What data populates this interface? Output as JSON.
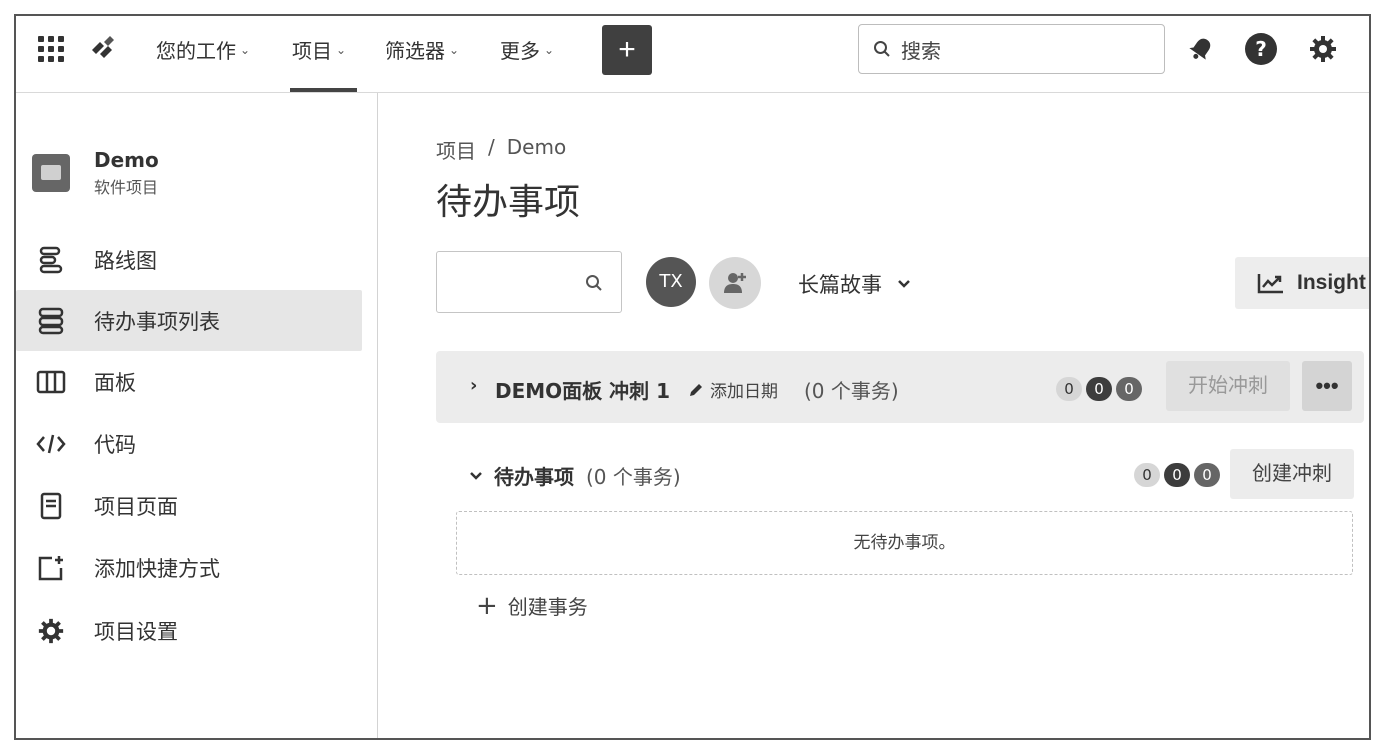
{
  "topbar": {
    "menus": [
      {
        "label": "您的工作"
      },
      {
        "label": "项目"
      },
      {
        "label": "筛选器"
      },
      {
        "label": "更多"
      }
    ],
    "create_label": "+",
    "search_placeholder": "搜索",
    "icons": [
      "apps-grid-icon",
      "jira-logo-icon",
      "notification-bell-icon",
      "help-icon",
      "settings-gear-icon"
    ],
    "help_glyph": "?"
  },
  "sidebar": {
    "project_name": "Demo",
    "project_type": "软件项目",
    "items": [
      {
        "label": "路线图",
        "icon": "roadmap-icon"
      },
      {
        "label": "待办事项列表",
        "icon": "backlog-icon",
        "active": true
      },
      {
        "label": "面板",
        "icon": "board-icon"
      },
      {
        "label": "代码",
        "icon": "code-icon"
      },
      {
        "label": "项目页面",
        "icon": "page-icon"
      },
      {
        "label": "添加快捷方式",
        "icon": "add-shortcut-icon"
      },
      {
        "label": "项目设置",
        "icon": "settings-gear-icon"
      }
    ]
  },
  "main": {
    "breadcrumb": {
      "root": "项目",
      "separator": "/",
      "current": "Demo"
    },
    "title": "待办事项",
    "avatar_initials": "TX",
    "epic_filter_label": "长篇故事",
    "insight_label": "Insight",
    "sprint": {
      "name": "DEMO面板 冲刺 1",
      "add_date_label": "添加日期",
      "count_label": "(0 个事务)",
      "badges": [
        "0",
        "0",
        "0"
      ],
      "start_label": "开始冲刺",
      "more_label": "•••"
    },
    "backlog": {
      "title": "待办事项",
      "count_label": "(0 个事务)",
      "badges": [
        "0",
        "0",
        "0"
      ],
      "create_sprint_label": "创建冲刺",
      "empty_text": "无待办事项。",
      "create_issue_plus": "+",
      "create_issue_label": "创建事务"
    }
  },
  "colors": {
    "active_bg": "#e6e6e6",
    "create_button_bg": "#404040",
    "sprint_row_bg": "#ececec"
  }
}
